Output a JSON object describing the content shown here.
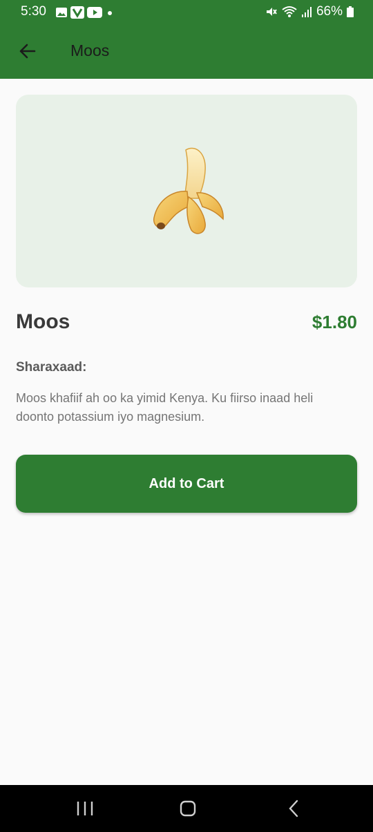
{
  "status_bar": {
    "time": "5:30",
    "battery": "66%",
    "notification_icons": [
      "gallery-icon",
      "v-app-icon",
      "youtube-icon",
      "dot-icon"
    ],
    "system_icons": [
      "mute-icon",
      "wifi-icon",
      "signal-icon",
      "battery-icon"
    ]
  },
  "app_bar": {
    "title": "Moos",
    "back_icon": "arrow-left-icon",
    "color": "#2e7d32"
  },
  "product": {
    "image_icon": "banana-emoji",
    "name": "Moos",
    "price": "$1.80",
    "description_label": "Sharaxaad:",
    "description": "Moos khafiif ah oo ka yimid Kenya. Ku fiirso inaad heli doonto potassium iyo magnesium."
  },
  "actions": {
    "add_to_cart_label": "Add to Cart",
    "accent": "#2e7d32"
  },
  "nav_bar": {
    "buttons": [
      "recents-icon",
      "home-icon",
      "back-icon"
    ]
  }
}
